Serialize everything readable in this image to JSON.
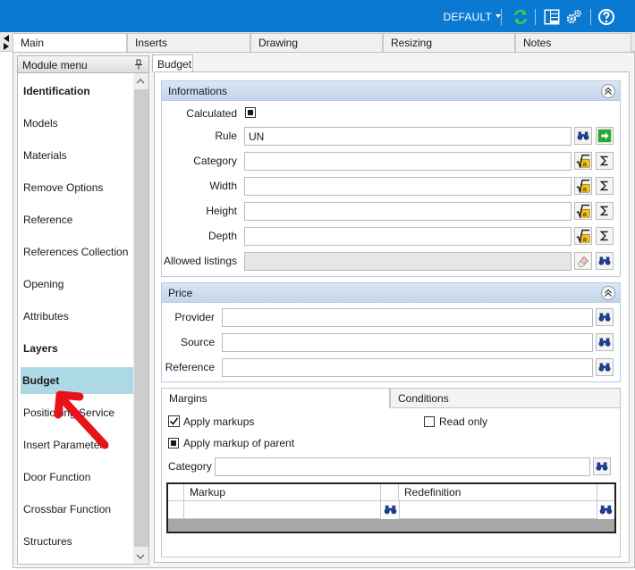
{
  "toolbar": {
    "profile": "DEFAULT",
    "icons": [
      "refresh-icon",
      "layout-icon",
      "settings-icon",
      "help-icon"
    ],
    "accent": "#0a79d2"
  },
  "main_tabs": [
    {
      "label": "Main",
      "active": true
    },
    {
      "label": "Inserts",
      "active": false
    },
    {
      "label": "Drawing",
      "active": false
    },
    {
      "label": "Resizing",
      "active": false
    },
    {
      "label": "Notes",
      "active": false
    }
  ],
  "module_menu": {
    "title": "Module menu",
    "items": [
      {
        "label": "Identification",
        "bold": true,
        "selected": false
      },
      {
        "label": "Models",
        "bold": false,
        "selected": false
      },
      {
        "label": "Materials",
        "bold": false,
        "selected": false
      },
      {
        "label": "Remove Options",
        "bold": false,
        "selected": false
      },
      {
        "label": "Reference",
        "bold": false,
        "selected": false
      },
      {
        "label": "References Collection",
        "bold": false,
        "selected": false
      },
      {
        "label": "Opening",
        "bold": false,
        "selected": false
      },
      {
        "label": "Attributes",
        "bold": false,
        "selected": false
      },
      {
        "label": "Layers",
        "bold": true,
        "selected": false
      },
      {
        "label": "Budget",
        "bold": true,
        "selected": true
      },
      {
        "label": "Positioning Service",
        "bold": false,
        "selected": false
      },
      {
        "label": "Insert Parameters",
        "bold": false,
        "selected": false
      },
      {
        "label": "Door Function",
        "bold": false,
        "selected": false
      },
      {
        "label": "Crossbar Function",
        "bold": false,
        "selected": false
      },
      {
        "label": "Structures",
        "bold": false,
        "selected": false
      }
    ],
    "selected_color": "#add8e6"
  },
  "content_tab": "Budget",
  "informations": {
    "title": "Informations",
    "calculated_label": "Calculated",
    "calculated_checked": true,
    "rule_label": "Rule",
    "rule_value": "UN",
    "category_label": "Category",
    "width_label": "Width",
    "height_label": "Height",
    "depth_label": "Depth",
    "allowed_listings_label": "Allowed listings"
  },
  "price": {
    "title": "Price",
    "provider_label": "Provider",
    "source_label": "Source",
    "reference_label": "Reference"
  },
  "margins_tabs": [
    {
      "label": "Margins",
      "active": true
    },
    {
      "label": "Conditions",
      "active": false
    }
  ],
  "margins": {
    "apply_markups_label": "Apply markups",
    "apply_markups_checked": true,
    "read_only_label": "Read only",
    "read_only_checked": false,
    "apply_markup_parent_label": "Apply markup of parent",
    "apply_markup_parent_checked": true,
    "category_label": "Category",
    "grid_columns": [
      "Markup",
      "Redefinition"
    ]
  },
  "annotation": {
    "color": "#e8121b"
  }
}
